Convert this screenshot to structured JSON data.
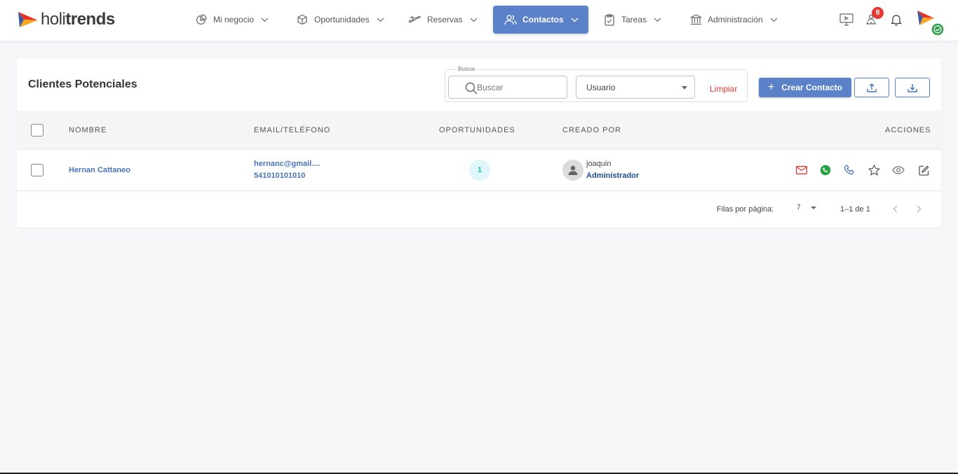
{
  "app": {
    "logo_light": "holi",
    "logo_bold": "trends"
  },
  "nav": {
    "items": [
      {
        "label": "Mi negocio",
        "icon": "pie-chart-icon"
      },
      {
        "label": "Oportunidades",
        "icon": "cube-icon"
      },
      {
        "label": "Reservas",
        "icon": "plane-icon"
      },
      {
        "label": "Contactos",
        "icon": "users-icon",
        "active": true
      },
      {
        "label": "Tareas",
        "icon": "clipboard-icon"
      },
      {
        "label": "Administración",
        "icon": "bank-icon"
      }
    ]
  },
  "top_icons": {
    "notifications_count": "8"
  },
  "colors": {
    "accent": "#5b82c9",
    "danger": "#e53935",
    "link": "#4a73b8",
    "whatsapp": "#25a244"
  },
  "page": {
    "title": "Clientes Potenciales"
  },
  "filters": {
    "search_legend": "Buscar",
    "search_placeholder": "Buscar",
    "user_select_value": "Usuario",
    "clear_label": "Limpiar"
  },
  "actions": {
    "create_label": "Crear Contacto",
    "upload_icon": "upload-icon",
    "download_icon": "download-icon"
  },
  "table": {
    "headers": {
      "name": "NOMBRE",
      "email_phone": "EMAIL/TELÉFONO",
      "opportunities": "OPORTUNIDADES",
      "created_by": "CREADO POR",
      "actions": "ACCIONES"
    },
    "rows": [
      {
        "name": "Hernan Cattaneo",
        "email": "hernanc@gmail....",
        "phone": "541010101010",
        "opportunities": "1",
        "created_by_name": "joaquin",
        "created_by_role": "Administrador"
      }
    ]
  },
  "pagination": {
    "rows_per_page_label": "Filas por página:",
    "rows_per_page_value": "7",
    "range": "1–1 de 1"
  }
}
